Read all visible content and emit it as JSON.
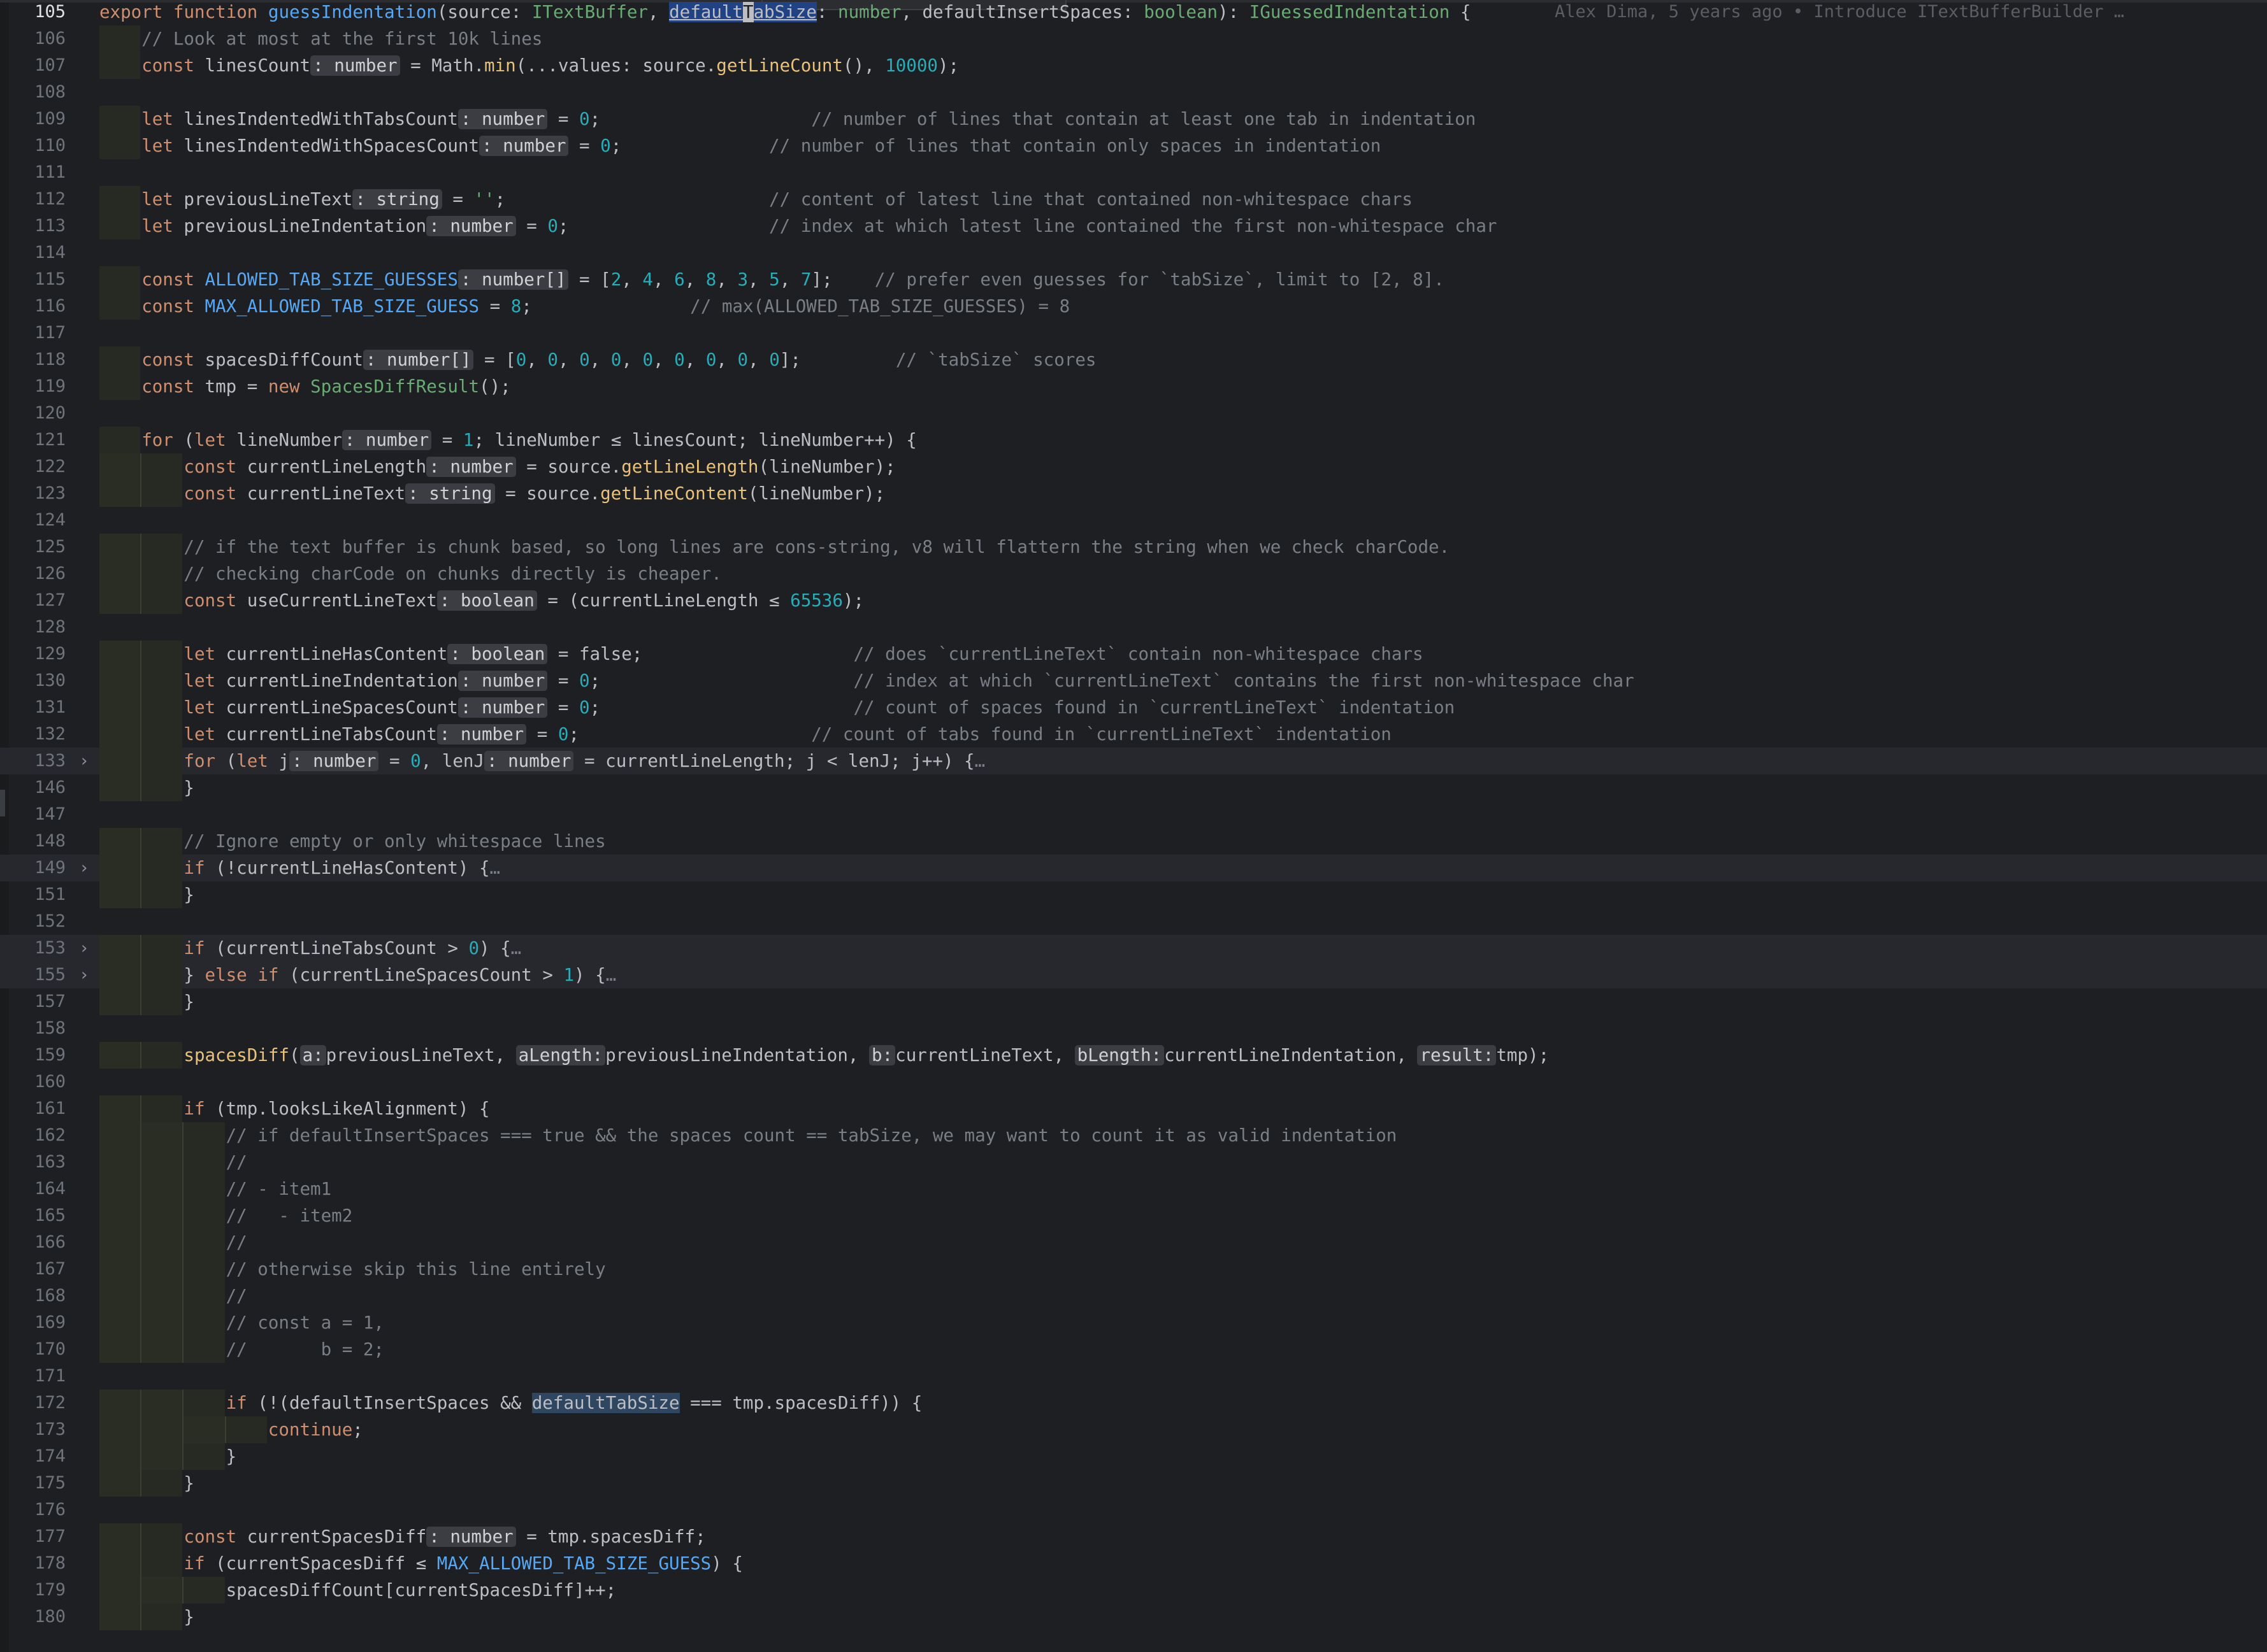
{
  "editor": {
    "active_line": "105",
    "blame": "Alex Dima, 5 years ago • Introduce ITextBufferBuilder …",
    "colors": {
      "background": "#1e1f22",
      "keyword": "#cf8e6d",
      "function": "#56a8f5",
      "type": "#6aab73",
      "number": "#2aacb8",
      "comment": "#7a7e85",
      "inlay_hint_bg": "#3b3d42"
    },
    "lines": [
      {
        "n": "105",
        "text": "export function guessIndentation(source: ITextBuffer, defaultTabSize: number, defaultInsertSpaces: boolean): IGuessedIndentation {"
      },
      {
        "n": "106",
        "text": "// Look at most at the first 10k lines"
      },
      {
        "n": "107",
        "text": "const linesCount : number = Math.min(...values: source.getLineCount(), 10000);"
      },
      {
        "n": "108",
        "text": ""
      },
      {
        "n": "109",
        "text": "let linesIndentedWithTabsCount : number = 0; // number of lines that contain at least one tab in indentation"
      },
      {
        "n": "110",
        "text": "let linesIndentedWithSpacesCount : number = 0; // number of lines that contain only spaces in indentation"
      },
      {
        "n": "111",
        "text": ""
      },
      {
        "n": "112",
        "text": "let previousLineText : string = ''; // content of latest line that contained non-whitespace chars"
      },
      {
        "n": "113",
        "text": "let previousLineIndentation : number = 0; // index at which latest line contained the first non-whitespace char"
      },
      {
        "n": "114",
        "text": ""
      },
      {
        "n": "115",
        "text": "const ALLOWED_TAB_SIZE_GUESSES : number[] = [2, 4, 6, 8, 3, 5, 7]; // prefer even guesses for `tabSize`, limit to [2, 8]."
      },
      {
        "n": "116",
        "text": "const MAX_ALLOWED_TAB_SIZE_GUESS = 8; // max(ALLOWED_TAB_SIZE_GUESSES) = 8"
      },
      {
        "n": "117",
        "text": ""
      },
      {
        "n": "118",
        "text": "const spacesDiffCount : number[] = [0, 0, 0, 0, 0, 0, 0, 0, 0]; // `tabSize` scores"
      },
      {
        "n": "119",
        "text": "const tmp = new SpacesDiffResult();"
      },
      {
        "n": "120",
        "text": ""
      },
      {
        "n": "121",
        "text": "for (let lineNumber : number = 1; lineNumber ≤ linesCount; lineNumber++) {"
      },
      {
        "n": "122",
        "text": "const currentLineLength : number = source.getLineLength(lineNumber);"
      },
      {
        "n": "123",
        "text": "const currentLineText : string = source.getLineContent(lineNumber);"
      },
      {
        "n": "124",
        "text": ""
      },
      {
        "n": "125",
        "text": "// if the text buffer is chunk based, so long lines are cons-string, v8 will flattern the string when we check charCode."
      },
      {
        "n": "126",
        "text": "// checking charCode on chunks directly is cheaper."
      },
      {
        "n": "127",
        "text": "const useCurrentLineText : boolean = (currentLineLength ≤ 65536);"
      },
      {
        "n": "128",
        "text": ""
      },
      {
        "n": "129",
        "text": "let currentLineHasContent : boolean = false; // does `currentLineText` contain non-whitespace chars"
      },
      {
        "n": "130",
        "text": "let currentLineIndentation : number = 0; // index at which `currentLineText` contains the first non-whitespace char"
      },
      {
        "n": "131",
        "text": "let currentLineSpacesCount : number = 0; // count of spaces found in `currentLineText` indentation"
      },
      {
        "n": "132",
        "text": "let currentLineTabsCount : number = 0; // count of tabs found in `currentLineText` indentation"
      },
      {
        "n": "133",
        "text": "for (let j : number = 0, lenJ : number = currentLineLength; j < lenJ; j++) {…"
      },
      {
        "n": "146",
        "text": "}"
      },
      {
        "n": "147",
        "text": ""
      },
      {
        "n": "148",
        "text": "// Ignore empty or only whitespace lines"
      },
      {
        "n": "149",
        "text": "if (!currentLineHasContent) {…"
      },
      {
        "n": "151",
        "text": "}"
      },
      {
        "n": "152",
        "text": ""
      },
      {
        "n": "153",
        "text": "if (currentLineTabsCount > 0) {…"
      },
      {
        "n": "155",
        "text": "} else if (currentLineSpacesCount > 1) {…"
      },
      {
        "n": "157",
        "text": "}"
      },
      {
        "n": "158",
        "text": ""
      },
      {
        "n": "159",
        "text": "spacesDiff(a: previousLineText, aLength: previousLineIndentation, b: currentLineText, bLength: currentLineIndentation, result: tmp);"
      },
      {
        "n": "160",
        "text": ""
      },
      {
        "n": "161",
        "text": "if (tmp.looksLikeAlignment) {"
      },
      {
        "n": "162",
        "text": "// if defaultInsertSpaces === true && the spaces count == tabSize, we may want to count it as valid indentation"
      },
      {
        "n": "163",
        "text": "//"
      },
      {
        "n": "164",
        "text": "// - item1"
      },
      {
        "n": "165",
        "text": "//   - item2"
      },
      {
        "n": "166",
        "text": "//"
      },
      {
        "n": "167",
        "text": "// otherwise skip this line entirely"
      },
      {
        "n": "168",
        "text": "//"
      },
      {
        "n": "169",
        "text": "// const a = 1,"
      },
      {
        "n": "170",
        "text": "//       b = 2;"
      },
      {
        "n": "171",
        "text": ""
      },
      {
        "n": "172",
        "text": "if (!(defaultInsertSpaces && defaultTabSize === tmp.spacesDiff)) {"
      },
      {
        "n": "173",
        "text": "continue;"
      },
      {
        "n": "174",
        "text": "}"
      },
      {
        "n": "175",
        "text": "}"
      },
      {
        "n": "176",
        "text": ""
      },
      {
        "n": "177",
        "text": "const currentSpacesDiff : number = tmp.spacesDiff;"
      },
      {
        "n": "178",
        "text": "if (currentSpacesDiff ≤ MAX_ALLOWED_TAB_SIZE_GUESS) {"
      },
      {
        "n": "179",
        "text": "spacesDiffCount[currentSpacesDiff]++;"
      },
      {
        "n": "180",
        "text": "}"
      }
    ]
  }
}
